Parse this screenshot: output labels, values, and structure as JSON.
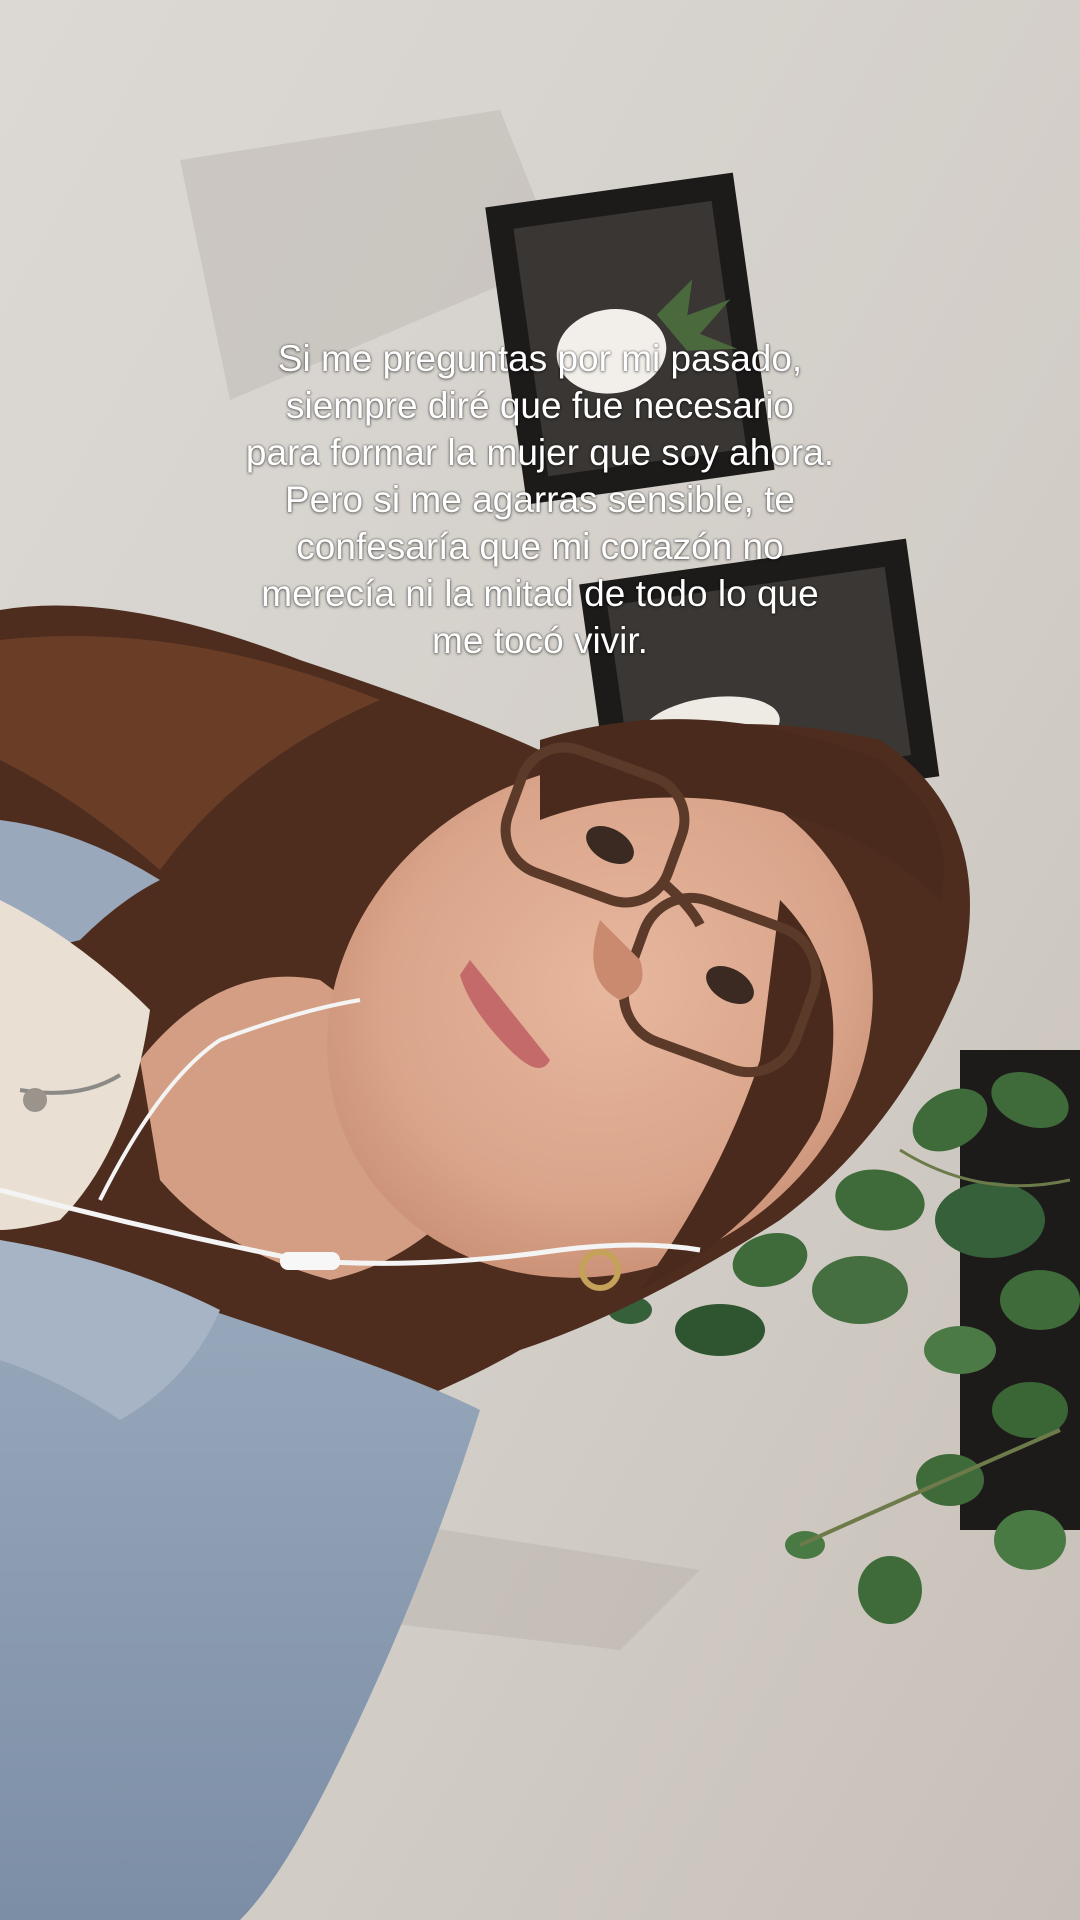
{
  "caption": {
    "lines": [
      "Si me preguntas por mi pasado,",
      "siempre diré que fue necesario",
      "para formar la mujer que soy ahora.",
      "Pero si me agarras sensible, te",
      "confesaría que mi corazón no",
      "merecía ni la mitad de todo lo que",
      "me tocó vivir."
    ],
    "color": "#ffffff"
  },
  "scene": {
    "wall_color": "#d6d2cd",
    "shelf_color": "#1c1a19",
    "hair_color": "#5a3422",
    "skin_color": "#d9a890",
    "denim_color": "#8b9bb0",
    "plant_color": "#3f6b3a"
  }
}
